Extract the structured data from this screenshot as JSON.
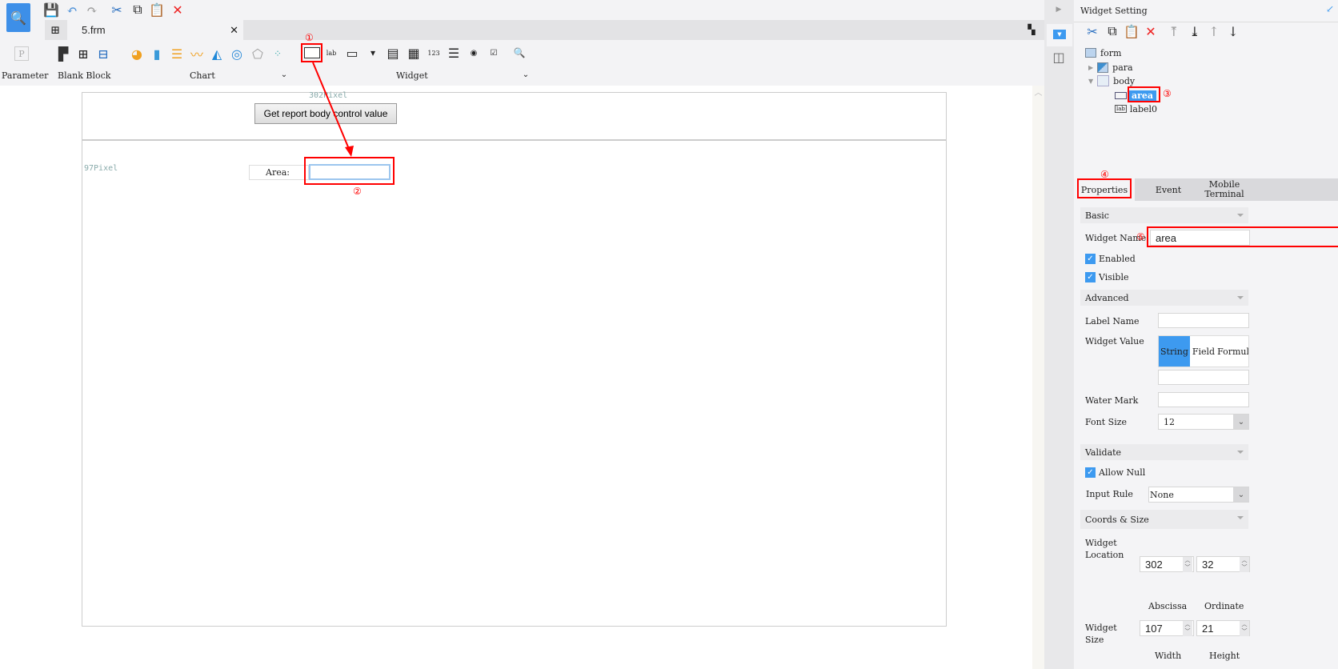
{
  "toolbar": {
    "tab_name": "5.frm",
    "groups": {
      "parameter": "Parameter",
      "blank_block": "Blank Block",
      "chart": "Chart",
      "widget": "Widget"
    }
  },
  "canvas": {
    "button_label": "Get report body control value",
    "x_ruler": "302Pixel",
    "y_ruler": "97Pixel",
    "area_label": "Area:"
  },
  "annotations": [
    "①",
    "②",
    "③",
    "④",
    "⑤"
  ],
  "panel": {
    "title": "Widget Setting",
    "tree": [
      "form",
      "para",
      "body",
      "area",
      "label0"
    ],
    "tabs": [
      "Properties",
      "Event",
      "Mobile Terminal"
    ],
    "sections": {
      "basic": "Basic",
      "advanced": "Advanced",
      "validate": "Validate",
      "coords": "Coords & Size"
    },
    "widget_name_label": "Widget Name",
    "widget_name": "area",
    "enabled": "Enabled",
    "visible": "Visible",
    "label_name": "Label Name",
    "widget_value": "Widget Value",
    "value_types": [
      "String",
      "Field",
      "Formula"
    ],
    "water_mark": "Water Mark",
    "font_size_label": "Font Size",
    "font_size": "12",
    "allow_null": "Allow Null",
    "input_rule_label": "Input Rule",
    "input_rule": "None",
    "location_label": "Widget Location",
    "x": "302",
    "y": "32",
    "abscissa": "Abscissa",
    "ordinate": "Ordinate",
    "size_label": "Widget Size",
    "width": "107",
    "height": "21",
    "width_label": "Width",
    "height_label": "Height"
  },
  "colors": {
    "accent": "#3d9af0",
    "annotation": "#ff0000"
  }
}
